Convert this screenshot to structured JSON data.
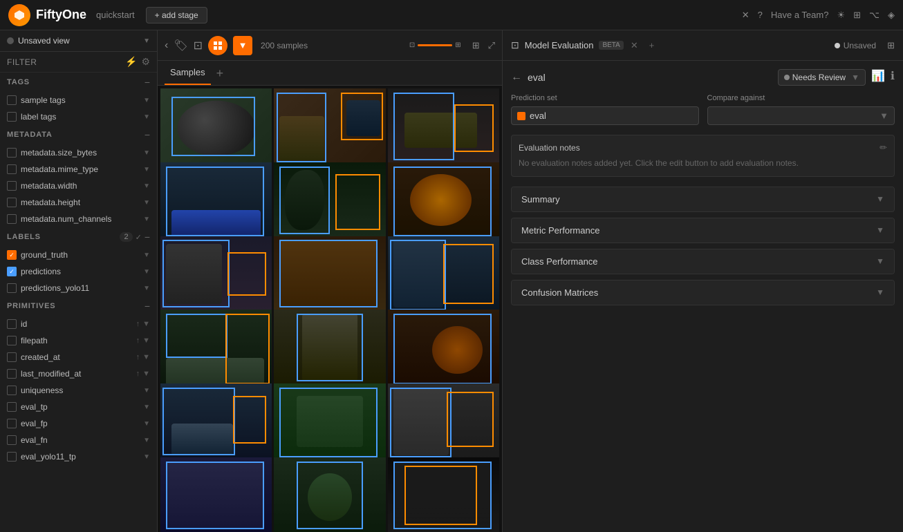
{
  "app": {
    "name": "FiftyOne",
    "context": "quickstart",
    "add_stage": "+ add stage"
  },
  "topbar": {
    "have_a_team": "Have a Team?",
    "close_label": "×",
    "help_label": "?"
  },
  "sidebar": {
    "view": {
      "name": "Unsaved view",
      "arrow": "▼"
    },
    "filter_label": "FILTER",
    "sections": {
      "tags": {
        "label": "TAGS",
        "items": [
          "sample tags",
          "label tags"
        ]
      },
      "metadata": {
        "label": "METADATA",
        "items": [
          "metadata.size_bytes",
          "metadata.mime_type",
          "metadata.width",
          "metadata.height",
          "metadata.num_channels"
        ]
      },
      "labels": {
        "label": "LABELS",
        "count": "2",
        "items": [
          {
            "name": "ground_truth",
            "checked": "orange"
          },
          {
            "name": "predictions",
            "checked": "blue"
          },
          {
            "name": "predictions_yolo11",
            "checked": "none"
          }
        ]
      },
      "primitives": {
        "label": "PRIMITIVES",
        "items": [
          "id",
          "filepath",
          "created_at",
          "last_modified_at",
          "uniqueness",
          "eval_tp",
          "eval_fp",
          "eval_fn",
          "eval_yolo11_tp"
        ]
      }
    }
  },
  "samples_panel": {
    "title": "Samples",
    "count": "200 samples",
    "add_label": "+"
  },
  "model_eval_panel": {
    "title": "Model Evaluation",
    "beta": "BETA",
    "eval_name": "eval",
    "needs_review": "Needs Review",
    "unsaved": "Unsaved",
    "prediction_set_label": "Prediction set",
    "prediction_value": "eval",
    "compare_against_label": "Compare against",
    "eval_notes_title": "Evaluation notes",
    "eval_notes_text": "No evaluation notes added yet. Click the edit button to add evaluation notes.",
    "sections": [
      {
        "label": "Summary"
      },
      {
        "label": "Metric Performance"
      },
      {
        "label": "Class Performance"
      },
      {
        "label": "Confusion Matrices"
      }
    ]
  },
  "images": [
    {
      "id": 1,
      "style": "img-1"
    },
    {
      "id": 2,
      "style": "img-2"
    },
    {
      "id": 3,
      "style": "img-3"
    },
    {
      "id": 4,
      "style": "img-4"
    },
    {
      "id": 5,
      "style": "img-5"
    },
    {
      "id": 6,
      "style": "img-6"
    },
    {
      "id": 7,
      "style": "img-1"
    },
    {
      "id": 8,
      "style": "img-2"
    },
    {
      "id": 9,
      "style": "img-3"
    },
    {
      "id": 10,
      "style": "img-4"
    },
    {
      "id": 11,
      "style": "img-5"
    },
    {
      "id": 12,
      "style": "img-6"
    },
    {
      "id": 13,
      "style": "img-1"
    },
    {
      "id": 14,
      "style": "img-2"
    },
    {
      "id": 15,
      "style": "img-3"
    },
    {
      "id": 16,
      "style": "img-4"
    },
    {
      "id": 17,
      "style": "img-5"
    },
    {
      "id": 18,
      "style": "img-6"
    }
  ]
}
